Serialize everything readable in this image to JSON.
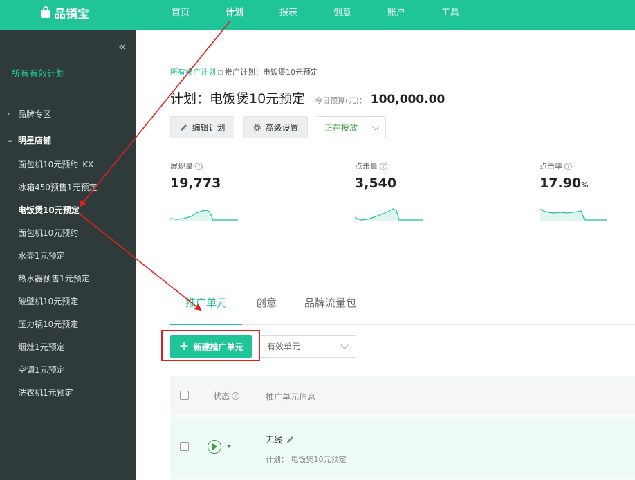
{
  "header": {
    "logo_text": "品销宝",
    "nav": [
      {
        "label": "首页",
        "active": false
      },
      {
        "label": "计划",
        "active": true
      },
      {
        "label": "报表",
        "active": false
      },
      {
        "label": "创意",
        "active": false
      },
      {
        "label": "账户",
        "active": false
      },
      {
        "label": "工具",
        "active": false
      }
    ]
  },
  "sidebar": {
    "all_plans": "所有有效计划",
    "groups": {
      "brand_zone": "品牌专区",
      "star_store": "明星店铺"
    },
    "plans": [
      "面包机10元预约_KX",
      "冰箱450预售1元预定",
      "电饭煲10元预定",
      "面包机10元预约",
      "水壶1元预定",
      "热水器预售1元预定",
      "破壁机10元预定",
      "压力锅10元预定",
      "烟灶1元预定",
      "空调1元预定",
      "洗衣机1元预定"
    ],
    "active_plan_index": 2
  },
  "main": {
    "breadcrumb": {
      "root": "所有推广计划",
      "current": "推广计划：电饭煲10元预定"
    },
    "title": "计划：电饭煲10元预定",
    "budget_label": "今日预算(元)：",
    "budget_value": "100,000.00",
    "buttons": {
      "edit": "编辑计划",
      "advanced": "高级设置",
      "status": "正在投放"
    },
    "metrics": [
      {
        "label": "展现量",
        "value": "19,773",
        "unit": ""
      },
      {
        "label": "点击量",
        "value": "3,540",
        "unit": ""
      },
      {
        "label": "点击率",
        "value": "17.90",
        "unit": "%"
      }
    ],
    "tabs": [
      {
        "label": "推广单元",
        "active": true
      },
      {
        "label": "创意",
        "active": false
      },
      {
        "label": "品牌流量包",
        "active": false
      }
    ],
    "new_unit_button": "新建推广单元",
    "unit_filter": "有效单元",
    "table": {
      "headers": {
        "status": "状态",
        "info": "推广单元信息"
      },
      "rows": [
        {
          "name": "无线",
          "plan": "计划： 电饭煲10元预定"
        }
      ]
    }
  },
  "colors": {
    "brand": "#1fc596",
    "sidebar": "#2f3b3a",
    "running": "#3aa13a",
    "annotation": "#e0211b"
  }
}
